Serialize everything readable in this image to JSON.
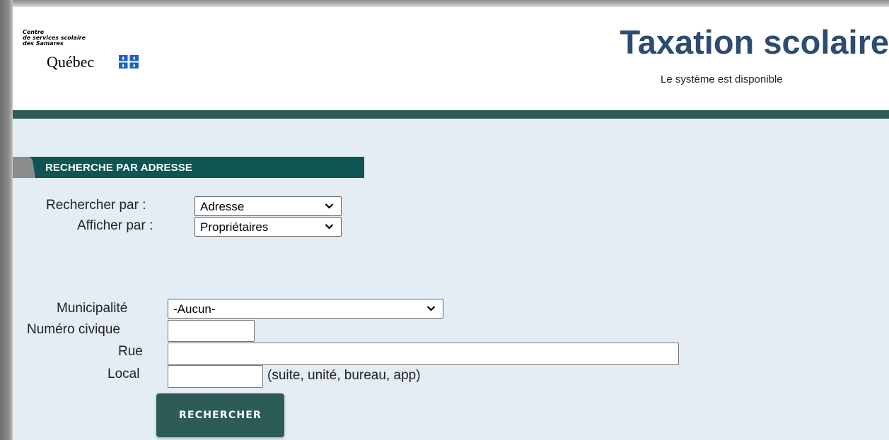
{
  "header": {
    "logo_lines": "Centre\nde services scolaire\ndes Samares",
    "logo_brand": "Québec",
    "title": "Taxation scolaire",
    "status": "Le système est disponible"
  },
  "section": {
    "title": "RECHERCHE PAR ADRESSE"
  },
  "search_options": {
    "search_by_label": "Rechercher par :",
    "search_by_value": "Adresse",
    "display_by_label": "Afficher par :",
    "display_by_value": "Propriétaires"
  },
  "address_form": {
    "municipality_label": "Municipalité",
    "municipality_value": "-Aucun-",
    "civic_number_label": "Numéro civique",
    "civic_number_value": "",
    "street_label": "Rue",
    "street_value": "",
    "local_label": "Local",
    "local_value": "",
    "local_hint": "(suite, unité, bureau, app)"
  },
  "actions": {
    "search_button": "RECHERCHER"
  },
  "colors": {
    "title": "#2e4b72",
    "header_bar": "#2d5c57",
    "banner": "#0e5553",
    "button": "#2d5c58",
    "page_background": "#e4ecf4"
  }
}
